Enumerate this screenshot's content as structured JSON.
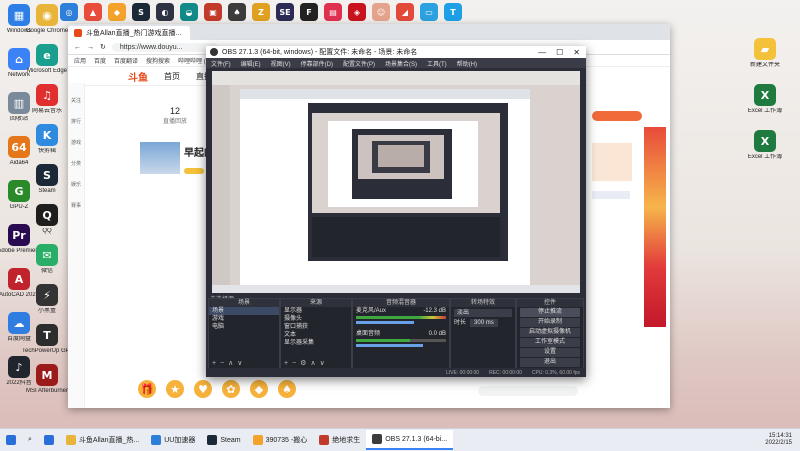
{
  "desktop": {
    "left_icons": [
      {
        "label": "Windows",
        "color": "#2d7ee6",
        "glyph": "▦"
      },
      {
        "label": "Network",
        "color": "#3b82f6",
        "glyph": "⌂"
      },
      {
        "label": "回收站",
        "color": "#7a8a9a",
        "glyph": "▥"
      },
      {
        "label": "Aida64",
        "color": "#e6761a",
        "glyph": "64"
      },
      {
        "label": "GPU-Z",
        "color": "#2a8a2a",
        "glyph": "G"
      },
      {
        "label": "Adobe Premiere",
        "color": "#2a0a50",
        "glyph": "Pr"
      },
      {
        "label": "AutoCAD 2021",
        "color": "#c0232b",
        "glyph": "A"
      },
      {
        "label": "百度网盘",
        "color": "#2f7de1",
        "glyph": "☁"
      },
      {
        "label": "2022抖音",
        "color": "#20252e",
        "glyph": "♪"
      }
    ],
    "second_col_icons": [
      {
        "label": "Google Chrome",
        "color": "#e8b53a",
        "glyph": "◉"
      },
      {
        "label": "Microsoft Edge",
        "color": "#1a9f8e",
        "glyph": "e"
      },
      {
        "label": "网易云音乐",
        "color": "#e12e2e",
        "glyph": "♫"
      },
      {
        "label": "快剪辑",
        "color": "#2f8be0",
        "glyph": "K"
      },
      {
        "label": "Steam",
        "color": "#1b2838",
        "glyph": "S"
      },
      {
        "label": "QQ",
        "color": "#1e1e1e",
        "glyph": "Q"
      },
      {
        "label": "微信",
        "color": "#2aae67",
        "glyph": "✉"
      },
      {
        "label": "小黑盒",
        "color": "#333",
        "glyph": "⚡"
      },
      {
        "label": "TechPowerUp GPU-Z",
        "color": "#2d2d2d",
        "glyph": "T"
      },
      {
        "label": "MSI Afterburner",
        "color": "#9b1b1b",
        "glyph": "M"
      }
    ],
    "top_icons": [
      {
        "color": "#2e7fd9",
        "glyph": "◎"
      },
      {
        "color": "#e84d3b",
        "glyph": "▲"
      },
      {
        "color": "#f3a32b",
        "glyph": "◆"
      },
      {
        "color": "#1b2838",
        "glyph": "S"
      },
      {
        "color": "#2d3342",
        "glyph": "◐"
      },
      {
        "color": "#128a8a",
        "glyph": "◒"
      },
      {
        "color": "#c23a2a",
        "glyph": "▣"
      },
      {
        "color": "#3c3c3c",
        "glyph": "♠"
      },
      {
        "color": "#e0a020",
        "glyph": "Z"
      },
      {
        "color": "#2b2b55",
        "glyph": "SE"
      },
      {
        "color": "#222",
        "glyph": "F"
      },
      {
        "color": "#e03050",
        "glyph": "▤"
      },
      {
        "color": "#c7141e",
        "glyph": "◈"
      },
      {
        "color": "#e4a38c",
        "glyph": "☺"
      },
      {
        "color": "#e24a3a",
        "glyph": "◢"
      },
      {
        "color": "#2aa1e0",
        "glyph": "▭"
      },
      {
        "color": "#1e9fe6",
        "glyph": "T"
      }
    ],
    "right_icons": [
      {
        "label": "新建文件夹",
        "color": "#f3c13a",
        "glyph": "▰"
      },
      {
        "label": "Excel 工作簿",
        "color": "#1f7a3f",
        "glyph": "X"
      },
      {
        "label": "Excel 工作簿",
        "color": "#1f7a3f",
        "glyph": "X"
      }
    ]
  },
  "browser": {
    "tab_title": "斗鱼Allan直播_热门游戏直播...",
    "url": "https://www.douyu...",
    "bookmarks": [
      "应用",
      "百度",
      "百度翻译",
      "搜狗搜索",
      "哔哩哔哩 (゜-゜)つロ 干杯~"
    ],
    "nav": {
      "logo": "斗鱼",
      "items": [
        "首页",
        "直播"
      ]
    },
    "side_items": [
      "关注",
      "排行",
      "游戏",
      "分类",
      "娱乐",
      "赛事"
    ],
    "stats": {
      "count": "12",
      "label": "直播回放"
    },
    "room_title": "早起的人"
  },
  "obs": {
    "title": "OBS 27.1.3 (64-bit, windows) - 配置文件: 未命名 - 场景: 未命名",
    "menu": [
      "文件(F)",
      "编辑(E)",
      "视图(V)",
      "停靠部件(D)",
      "配置文件(P)",
      "场景集合(S)",
      "工具(T)",
      "帮助(H)"
    ],
    "no_source": "未选择源",
    "docks": {
      "scenes": {
        "title": "场景",
        "items": [
          "场景",
          "游戏",
          "电脑"
        ]
      },
      "sources": {
        "title": "来源",
        "items": [
          "显示器",
          "摄像头",
          "窗口捕获",
          "文本",
          "显示器采集"
        ]
      },
      "mixer": {
        "title": "音频混音器",
        "channels": [
          {
            "name": "麦克风/Aux",
            "db": "-12.3 dB"
          },
          {
            "name": "桌面音频",
            "db": "0.0 dB"
          }
        ]
      },
      "transitions": {
        "title": "转场特效",
        "type": "淡出",
        "duration_label": "时长",
        "duration": "300 ms"
      },
      "controls": {
        "title": "控件",
        "buttons": [
          "停止推流",
          "开始录制",
          "启动虚拟摄像机",
          "工作室模式",
          "设置",
          "退出"
        ]
      }
    },
    "status": [
      "LIVE: 00:00:00",
      "REC: 00:00:00",
      "CPU: 0.3%, 60.00 fps"
    ]
  },
  "taskbar": {
    "items": [
      {
        "label": "",
        "color": "#2a6ed8"
      },
      {
        "label": "斗鱼Allan直播_热...",
        "color": "#e8b53a"
      },
      {
        "label": "UU加速器",
        "color": "#2e7fd9"
      },
      {
        "label": "Steam",
        "color": "#1b2838"
      },
      {
        "label": "390735 -搬心",
        "color": "#f3a32b"
      },
      {
        "label": "绝地求生",
        "color": "#c23a2a"
      },
      {
        "label": "OBS 27.1.3 (64-bi...",
        "color": "#3c3c3c"
      }
    ],
    "active_index": 6,
    "time": "15:14:31",
    "date": "2022/2/15"
  }
}
